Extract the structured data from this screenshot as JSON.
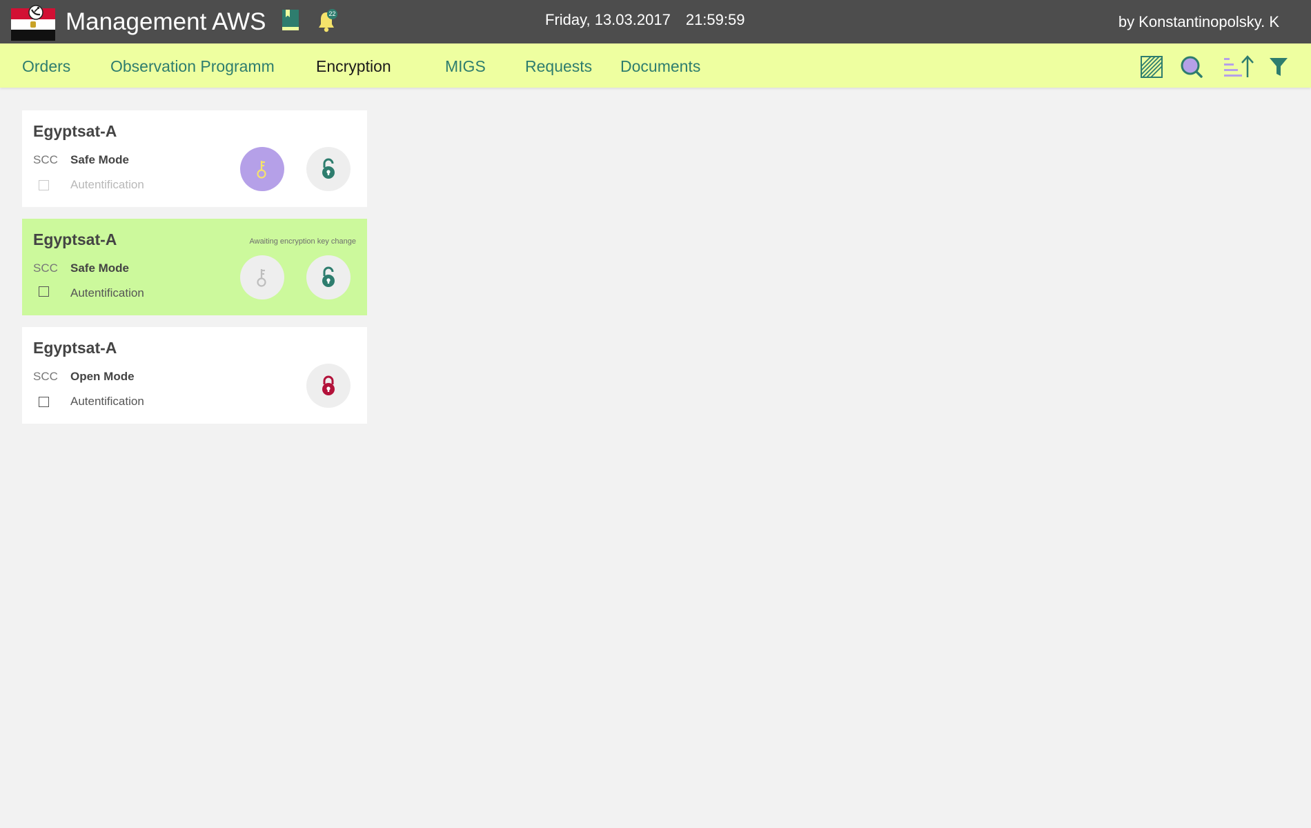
{
  "header": {
    "title": "Management AWS",
    "date": "Friday, 13.03.2017",
    "time": "21:59:59",
    "user": "by Konstantinopolsky. K",
    "notification_count": "22"
  },
  "nav": {
    "items": [
      {
        "label": "Orders",
        "active": false
      },
      {
        "label": "Observation Programm",
        "active": false
      },
      {
        "label": "Encryption",
        "active": true
      },
      {
        "label": "MIGS",
        "active": false
      },
      {
        "label": "Requests",
        "active": false
      },
      {
        "label": "Documents",
        "active": false
      }
    ],
    "tools": [
      "hatch-pattern-icon",
      "search-icon",
      "sort-ascending-icon",
      "filter-icon"
    ]
  },
  "cards": [
    {
      "title": "Egyptsat-A",
      "code": "SCC",
      "mode": "Safe Mode",
      "auth_label": "Autentification",
      "auth_disabled": true,
      "status": "",
      "key_button": "active",
      "lock": "unlocked"
    },
    {
      "title": "Egyptsat-A",
      "code": "SCC",
      "mode": "Safe Mode",
      "auth_label": "Autentification",
      "auth_disabled": false,
      "status": "Awaiting encryption key change",
      "key_button": "disabled",
      "lock": "unlocked"
    },
    {
      "title": "Egyptsat-A",
      "code": "SCC",
      "mode": "Open Mode",
      "auth_label": "Autentification",
      "auth_disabled": false,
      "status": "",
      "key_button": "none",
      "lock": "locked"
    }
  ],
  "colors": {
    "topbar": "#4d4d4d",
    "navbar": "#eeffa0",
    "accent": "#2e7d6e",
    "highlight_card": "#ccf99c",
    "key_active": "#b5a0e8",
    "key_glyph": "#f5e36b",
    "locked": "#b3123a",
    "sort_bars": "#b5a0e8"
  }
}
